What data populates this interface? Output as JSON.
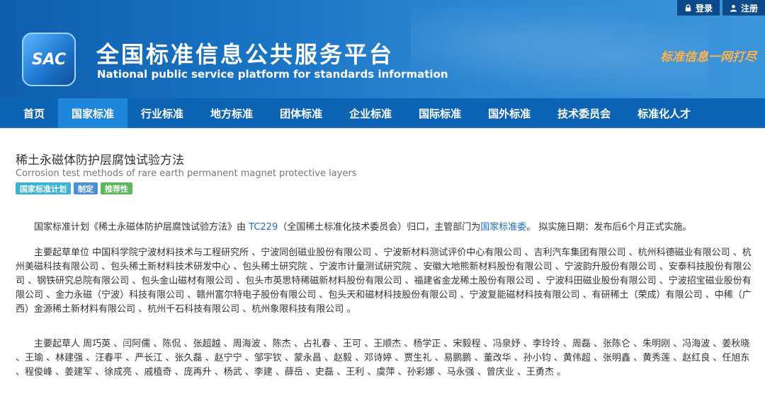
{
  "header": {
    "login_label": "登录",
    "register_label": "注册",
    "logo_text": "SAC",
    "title": "全国标准信息公共服务平台",
    "subtitle": "National public service platform  for standards information",
    "slogan": "标准信息一网打尽"
  },
  "nav": {
    "items": [
      "首页",
      "国家标准",
      "行业标准",
      "地方标准",
      "团体标准",
      "企业标准",
      "国际标准",
      "国外标准",
      "技术委员会",
      "标准化人才"
    ],
    "active_index": 1
  },
  "standard": {
    "title": "稀土永磁体防护层腐蚀试验方法",
    "title_en": "Corrosion test methods of rare earth permanent magnet protective layers",
    "badges": [
      "国家标准计划",
      "制定",
      "推荐性"
    ]
  },
  "intro": {
    "part1": "国家标准计划《稀土永磁体防护层腐蚀试验方法》由 ",
    "tc_link": "TC229",
    "part2": "（全国稀土标准化技术委员会）归口，主管部门为",
    "dept_link": "国家标准委",
    "part3": "。 拟实施日期：发布后6个月正式实施。"
  },
  "drafting_units": "主要起草单位 中国科学院宁波材料技术与工程研究所 、宁波同创磁业股份有限公司 、宁波新材料测试评价中心有限公司 、吉利汽车集团有限公司 、杭州科德磁业有限公司 、杭州美磁科技有限公司 、包头稀土新材料技术研发中心 、包头稀土研究院 、宁波市计量测试研究院 、安徽大地熊新材料股份有限公司 、宁波韵升股份有限公司 、安泰科技股份有限公司 、钢铁研究总院有限公司 、包头金山磁材有限公司 、包头市英思特稀磁新材料股份有限公司 、福建省金龙稀土股份有限公司 、宁波科田磁业股份有限公司 、宁波招宝磁业股份有限公司 、金力永磁（宁波）科技有限公司 、赣州富尔特电子股份有限公司 、包头天和磁材科技股份有限公司 、宁波复能磁材科技有限公司 、有研稀土（荣成）有限公司 、中稀（广西）金源稀土新材料有限公司 、杭州千石科技有限公司 、杭州象限科技有限公司 。",
  "drafters": "主要起草人 周巧英 、闫阿儒 、陈侃 、张超越 、周海波 、陈杰 、占礼春 、王可 、王顺杰 、杨学正 、宋毅程 、冯泉妤 、李玲玲 、周磊 、张陈仑 、朱明刚 、冯海波 、姜秋晓 、王瑜 、林建强 、汪春平 、严长江 、张久磊 、赵宁宁 、邹宇钦 、蒙永昌 、赵毅 、邓诗婷 、贾生礼 、易鹏鹏 、董改华 、孙小钧 、黄伟超 、张明鑫 、黄秀莲 、赵红良 、任旭东 、程俊峰 、姜建军 、徐成亮 、戚植奇 、庞再升 、杨武 、李建 、薛岳 、史磊 、王利 、虞萍 、孙彩娜 、马永强 、曾庆业 、王勇杰 。"
}
